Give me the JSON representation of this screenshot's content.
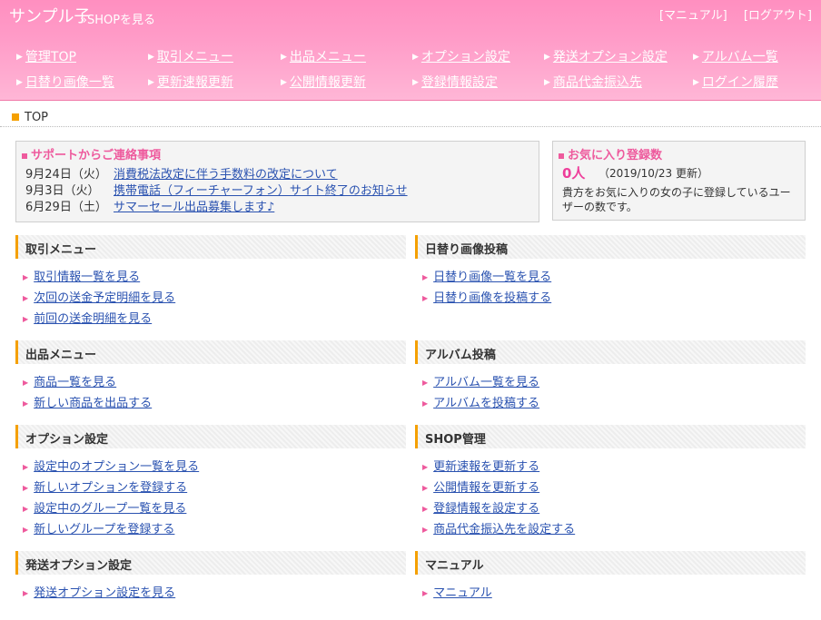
{
  "header": {
    "brand": "サンプル子",
    "shop_link": "»SHOPを見る",
    "manual_link": "[マニュアル]",
    "logout_link": "[ログアウト]"
  },
  "nav": [
    [
      "管理TOP",
      "取引メニュー",
      "出品メニュー",
      "オプション設定",
      "発送オプション設定",
      "アルバム一覧"
    ],
    [
      "日替り画像一覧",
      "更新速報更新",
      "公開情報更新",
      "登録情報設定",
      "商品代金振込先",
      "ログイン履歴"
    ]
  ],
  "breadcrumb": "TOP",
  "support": {
    "title": "サポートからご連絡事項",
    "items": [
      {
        "date": "9月24日（火）",
        "text": "消費税法改定に伴う手数料の改定について"
      },
      {
        "date": "9月3日（火）",
        "text": "携帯電話（フィーチャーフォン）サイト終了のお知らせ"
      },
      {
        "date": "6月29日（土）",
        "text": "サマーセール出品募集します♪"
      }
    ]
  },
  "favorite": {
    "title": "お気に入り登録数",
    "count": "0人",
    "updated": "（2019/10/23 更新）",
    "description": "貴方をお気に入りの女の子に登録しているユーザーの数です。"
  },
  "sections": [
    {
      "title": "取引メニュー",
      "items": [
        "取引情報一覧を見る",
        "次回の送金予定明細を見る",
        "前回の送金明細を見る"
      ]
    },
    {
      "title": "日替り画像投稿",
      "items": [
        "日替り画像一覧を見る",
        "日替り画像を投稿する"
      ]
    },
    {
      "title": "出品メニュー",
      "items": [
        "商品一覧を見る",
        "新しい商品を出品する"
      ]
    },
    {
      "title": "アルバム投稿",
      "items": [
        "アルバム一覧を見る",
        "アルバムを投稿する"
      ]
    },
    {
      "title": "オプション設定",
      "items": [
        "設定中のオプション一覧を見る",
        "新しいオプションを登録する",
        "設定中のグループ一覧を見る",
        "新しいグループを登録する"
      ]
    },
    {
      "title": "SHOP管理",
      "items": [
        "更新速報を更新する",
        "公開情報を更新する",
        "登録情報を設定する",
        "商品代金振込先を設定する"
      ]
    },
    {
      "title": "発送オプション設定",
      "items": [
        "発送オプション設定を見る"
      ]
    },
    {
      "title": "マニュアル",
      "items": [
        "マニュアル"
      ]
    }
  ],
  "colors": {
    "header": "#ff9cc8",
    "accent": "#ee5a9d",
    "bullet": "#f5a000",
    "link": "#2a52b0"
  }
}
